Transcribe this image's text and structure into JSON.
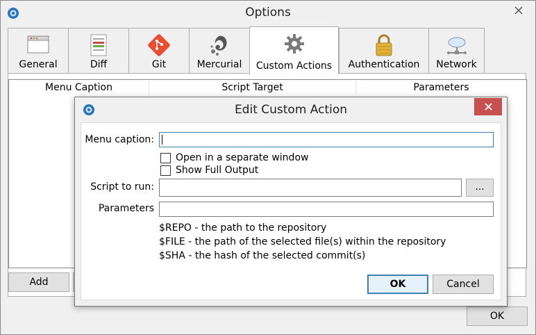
{
  "window": {
    "title": "Options"
  },
  "tabs": [
    {
      "label": "General",
      "icon": "window-icon"
    },
    {
      "label": "Diff",
      "icon": "diff-icon"
    },
    {
      "label": "Git",
      "icon": "git-icon"
    },
    {
      "label": "Mercurial",
      "icon": "mercurial-icon"
    },
    {
      "label": "Custom Actions",
      "icon": "gear-icon"
    },
    {
      "label": "Authentication",
      "icon": "padlock-icon"
    },
    {
      "label": "Network",
      "icon": "network-cloud-icon"
    }
  ],
  "active_tab": "Custom Actions",
  "table": {
    "columns": [
      "Menu Caption",
      "Script Target",
      "Parameters"
    ]
  },
  "buttons": {
    "add": "Add",
    "ok": "OK"
  },
  "dialog": {
    "title": "Edit Custom Action",
    "menu_caption_label": "Menu caption:",
    "menu_caption_value": "",
    "open_separate_label": "Open in a separate window",
    "show_full_output_label": "Show Full Output",
    "script_label": "Script to run:",
    "script_value": "",
    "browse_label": "...",
    "parameters_label": "Parameters",
    "parameters_value": "",
    "help_lines": [
      "$REPO - the path to the repository",
      "$FILE - the path of the selected file(s) within the repository",
      "$SHA - the hash of the selected commit(s)"
    ],
    "ok_label": "OK",
    "cancel_label": "Cancel"
  },
  "colors": {
    "accent": "#3c7fb1",
    "close_red": "#c75050"
  }
}
